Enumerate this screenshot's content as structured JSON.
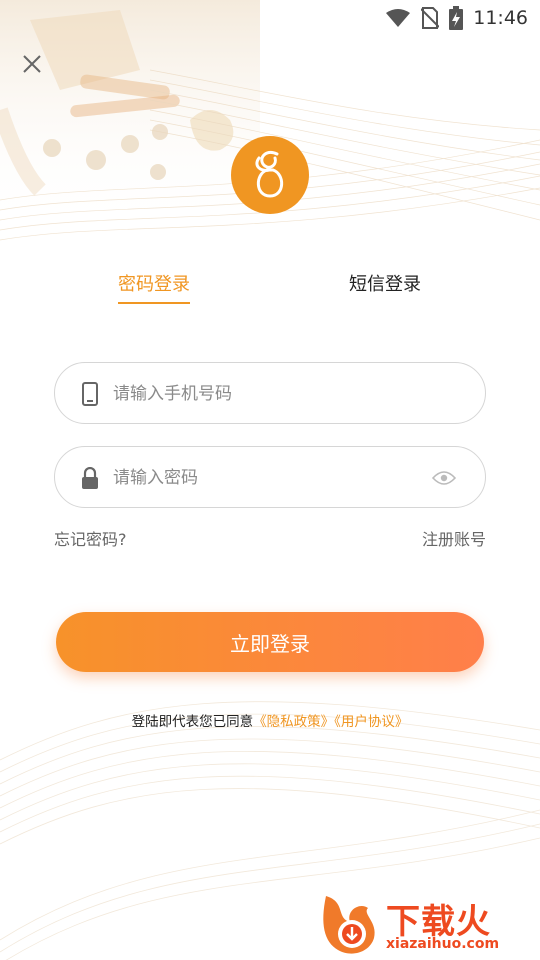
{
  "status_bar": {
    "time": "11:46"
  },
  "tabs": {
    "password_login": "密码登录",
    "sms_login": "短信登录"
  },
  "form": {
    "phone_placeholder": "请输入手机号码",
    "password_placeholder": "请输入密码"
  },
  "links": {
    "forgot_password": "忘记密码?",
    "register": "注册账号"
  },
  "login_button": "立即登录",
  "agreement": {
    "prefix": "登陆即代表您已同意",
    "privacy": "《隐私政策》",
    "terms": "《用户协议》"
  },
  "watermark": {
    "title": "下载火",
    "site": "xiazaihuo.com"
  },
  "colors": {
    "accent": "#f09622",
    "button_start": "#f7922a",
    "button_end": "#ff7f4a",
    "watermark": "#ee4a20"
  },
  "icons": [
    "wifi-icon",
    "no-sim-icon",
    "battery-charging-icon",
    "close-icon",
    "app-logo-icon",
    "phone-icon",
    "lock-icon",
    "eye-icon"
  ]
}
